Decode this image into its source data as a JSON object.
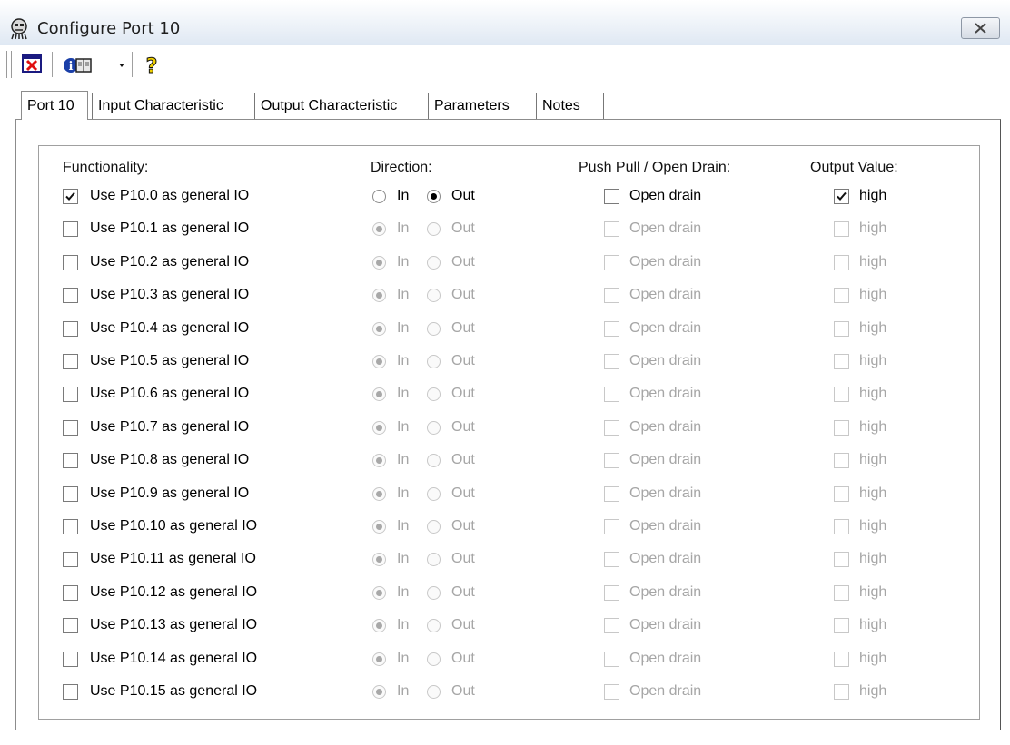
{
  "window": {
    "title": "Configure Port 10"
  },
  "toolbar": {
    "icons": [
      "close-red-icon",
      "info-book-icon",
      "dropdown-arrow-icon",
      "help-icon"
    ]
  },
  "tabs": [
    {
      "label": "Port 10",
      "active": true
    },
    {
      "label": "Input Characteristic",
      "active": false
    },
    {
      "label": "Output Characteristic",
      "active": false
    },
    {
      "label": "Parameters",
      "active": false
    },
    {
      "label": "Notes",
      "active": false
    }
  ],
  "headers": {
    "functionality": "Functionality:",
    "direction": "Direction:",
    "push_pull": "Push Pull / Open Drain:",
    "output_value": "Output Value:"
  },
  "labels": {
    "in": "In",
    "out": "Out",
    "open_drain": "Open drain",
    "high": "high"
  },
  "rows": [
    {
      "label": "Use P10.0 as general IO",
      "use": true,
      "direction": "Out",
      "open_drain": false,
      "high": true
    },
    {
      "label": "Use P10.1 as general IO",
      "use": false,
      "direction": "In",
      "open_drain": false,
      "high": false
    },
    {
      "label": "Use P10.2 as general IO",
      "use": false,
      "direction": "In",
      "open_drain": false,
      "high": false
    },
    {
      "label": "Use P10.3 as general IO",
      "use": false,
      "direction": "In",
      "open_drain": false,
      "high": false
    },
    {
      "label": "Use P10.4 as general IO",
      "use": false,
      "direction": "In",
      "open_drain": false,
      "high": false
    },
    {
      "label": "Use P10.5 as general IO",
      "use": false,
      "direction": "In",
      "open_drain": false,
      "high": false
    },
    {
      "label": "Use P10.6 as general IO",
      "use": false,
      "direction": "In",
      "open_drain": false,
      "high": false
    },
    {
      "label": "Use P10.7 as general IO",
      "use": false,
      "direction": "In",
      "open_drain": false,
      "high": false
    },
    {
      "label": "Use P10.8 as general IO",
      "use": false,
      "direction": "In",
      "open_drain": false,
      "high": false
    },
    {
      "label": "Use P10.9 as general IO",
      "use": false,
      "direction": "In",
      "open_drain": false,
      "high": false
    },
    {
      "label": "Use P10.10 as general IO",
      "use": false,
      "direction": "In",
      "open_drain": false,
      "high": false
    },
    {
      "label": "Use P10.11 as general IO",
      "use": false,
      "direction": "In",
      "open_drain": false,
      "high": false
    },
    {
      "label": "Use P10.12 as general IO",
      "use": false,
      "direction": "In",
      "open_drain": false,
      "high": false
    },
    {
      "label": "Use P10.13 as general IO",
      "use": false,
      "direction": "In",
      "open_drain": false,
      "high": false
    },
    {
      "label": "Use P10.14 as general IO",
      "use": false,
      "direction": "In",
      "open_drain": false,
      "high": false
    },
    {
      "label": "Use P10.15 as general IO",
      "use": false,
      "direction": "In",
      "open_drain": false,
      "high": false
    }
  ]
}
